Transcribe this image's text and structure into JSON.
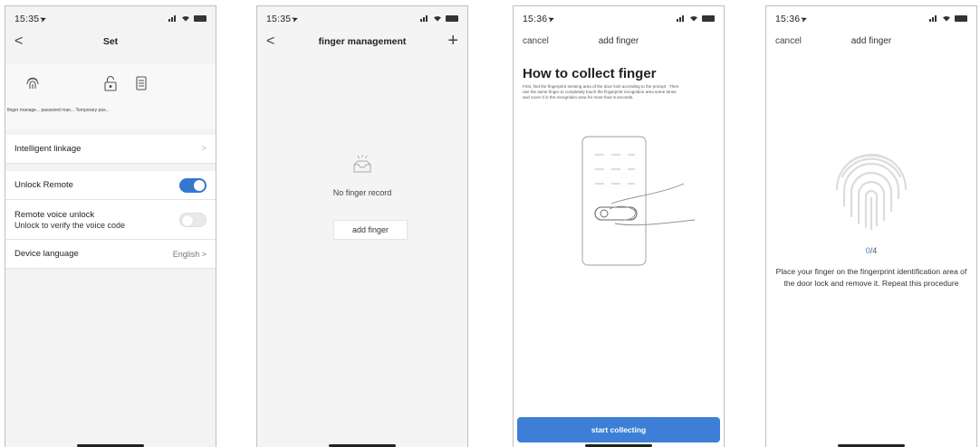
{
  "status": {
    "time": "15:35",
    "time_alt": "15:36"
  },
  "screen1": {
    "back": "<",
    "title": "Set",
    "quick_labels": "finger manage... password man... Temporary pas...",
    "rows": [
      {
        "label": "Intelligent linkage",
        "value": ">"
      },
      {
        "label": "Unlock Remote"
      },
      {
        "label": "Remote voice unlock",
        "sub": "Unlock to verify the voice code"
      },
      {
        "label": "Device language",
        "value": "English >"
      }
    ]
  },
  "screen2": {
    "back": "<",
    "title": "finger management",
    "plus": "+",
    "empty_text": "No finger record",
    "add_label": "add finger"
  },
  "screen3": {
    "cancel": "cancel",
    "title": "add finger",
    "heading": "How to collect finger",
    "description": "First, find the fingerprint sensing area of the door lock according to the prompt . Then use the same finger to completely touch the fingerprint recognition area some times and cover it in the recognition area for more than 5 seconds.",
    "button": "start collecting"
  },
  "screen4": {
    "cancel": "cancel",
    "title": "add finger",
    "count_current": "0",
    "count_total": "/4",
    "instruction": "Place your finger on the fingerprint identification area of the door lock and remove it. Repeat this procedure"
  },
  "colors": {
    "accent": "#3d7fd6",
    "toggle_on": "#3577d0"
  }
}
